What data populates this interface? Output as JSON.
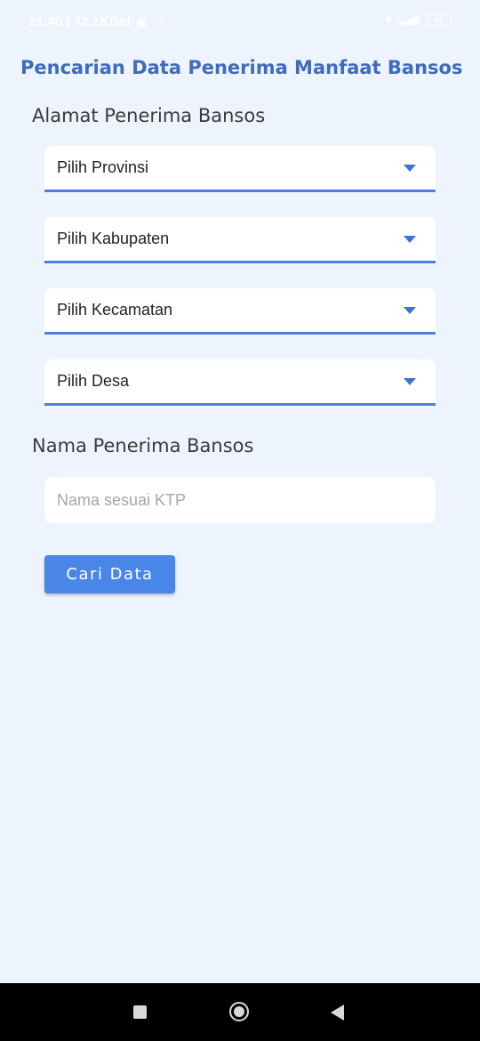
{
  "status_bar": {
    "time_and_speed": "21:40 | 72.1KB/d",
    "more": "···",
    "battery": "61"
  },
  "app": {
    "title": "Pencarian Data Penerima Manfaat Bansos"
  },
  "address_section": {
    "title": "Alamat Penerima Bansos",
    "province": "Pilih Provinsi",
    "regency": "Pilih Kabupaten",
    "district": "Pilih Kecamatan",
    "village": "Pilih Desa"
  },
  "name_section": {
    "title": "Nama Penerima Bansos",
    "placeholder": "Nama sesuai KTP",
    "value": ""
  },
  "search_button": {
    "label": "Cari Data"
  },
  "colors": {
    "background": "#eef4fd",
    "title": "#3f6bbf",
    "accent": "#4a86e8",
    "underline": "#4a80e0"
  }
}
